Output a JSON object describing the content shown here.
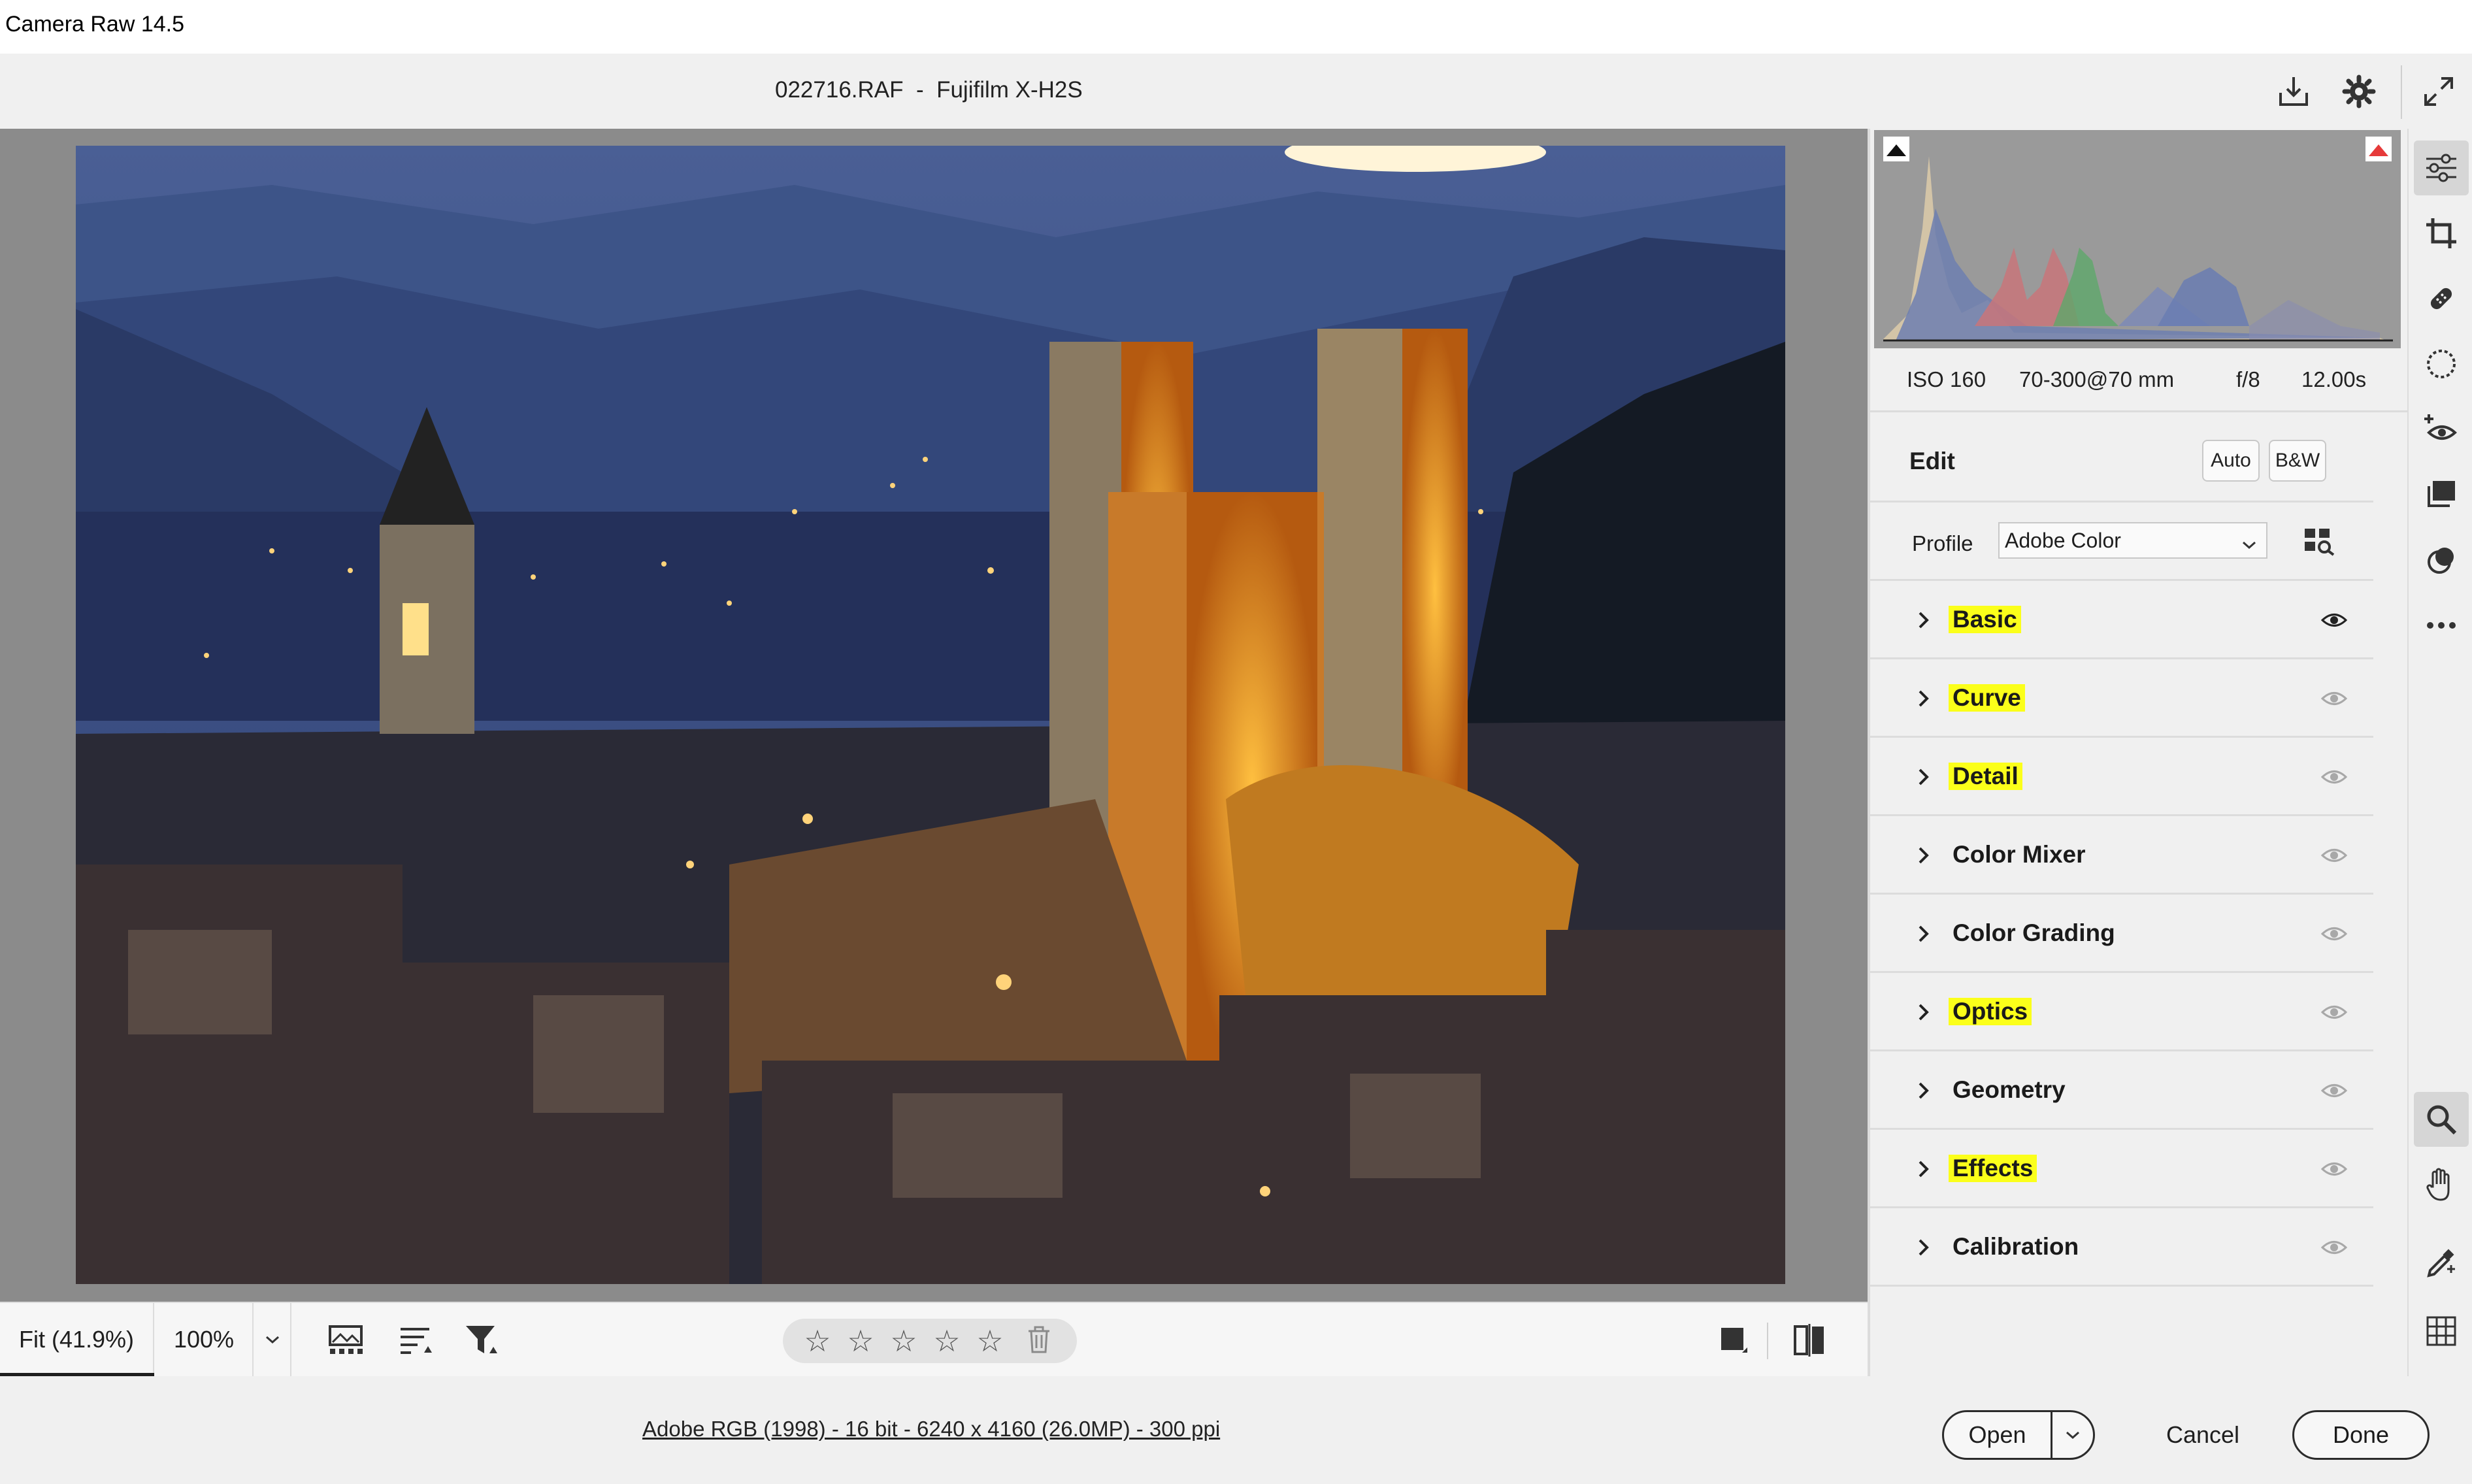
{
  "window": {
    "app_title": "Camera Raw 14.5"
  },
  "header": {
    "file_title": "022716.RAF  -  Fujifilm X-H2S",
    "icons": [
      "save-icon",
      "settings-gear-icon",
      "fullscreen-icon"
    ]
  },
  "canvas_toolbar": {
    "zoom_fit": "Fit (41.9%)",
    "zoom_100": "100%",
    "icons": [
      "filmstrip-icon",
      "sort-icon",
      "filter-icon",
      "before-after-toggle-icon",
      "compare-view-icon"
    ],
    "rating": {
      "stars": [
        "☆",
        "☆",
        "☆",
        "☆",
        "☆"
      ],
      "value": 0
    }
  },
  "statusbar": {
    "file_info": "Adobe RGB (1998) - 16 bit - 6240 x 4160 (26.0MP) - 300 ppi"
  },
  "exif": {
    "iso": "ISO 160",
    "lens": "70-300@70 mm",
    "aperture": "f/8",
    "shutter": "12.00s"
  },
  "edit": {
    "title": "Edit",
    "auto_label": "Auto",
    "bw_label": "B&W",
    "profile_label": "Profile",
    "profile_value": "Adobe Color"
  },
  "sections": [
    {
      "label": "Basic",
      "highlighted": true,
      "eye_active": true
    },
    {
      "label": "Curve",
      "highlighted": true,
      "eye_active": false
    },
    {
      "label": "Detail",
      "highlighted": true,
      "eye_active": false
    },
    {
      "label": "Color Mixer",
      "highlighted": false,
      "eye_active": false
    },
    {
      "label": "Color Grading",
      "highlighted": false,
      "eye_active": false
    },
    {
      "label": "Optics",
      "highlighted": true,
      "eye_active": false
    },
    {
      "label": "Geometry",
      "highlighted": false,
      "eye_active": false
    },
    {
      "label": "Effects",
      "highlighted": true,
      "eye_active": false
    },
    {
      "label": "Calibration",
      "highlighted": false,
      "eye_active": false
    }
  ],
  "rail": {
    "icons": [
      "edit-sliders-icon",
      "crop-icon",
      "healing-icon",
      "masking-icon",
      "red-eye-icon",
      "presets-icon",
      "snapshots-icon",
      "more-icon",
      "zoom-icon",
      "hand-icon",
      "color-sampler-icon",
      "grid-icon"
    ],
    "active": "edit-sliders-icon"
  },
  "footer": {
    "open_label": "Open",
    "cancel_label": "Cancel",
    "done_label": "Done"
  },
  "colors": {
    "highlight": "#fbff1a",
    "panel_bg": "#f0f0f0",
    "canvas_bg": "#8b8b8b"
  }
}
